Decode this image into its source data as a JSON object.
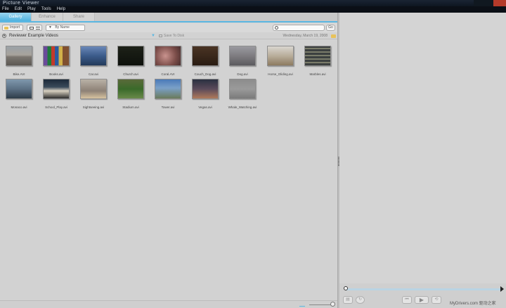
{
  "window": {
    "title": "Picture Viewer"
  },
  "menu": {
    "items": [
      "File",
      "Edit",
      "Play",
      "Tools",
      "Help"
    ]
  },
  "tabs": [
    {
      "label": "Gallery",
      "active": true
    },
    {
      "label": "Enhance",
      "active": false
    },
    {
      "label": "Share",
      "active": false
    }
  ],
  "toolbar": {
    "import_label": "Import",
    "sort_value": "By Name",
    "go_label": "Go"
  },
  "album": {
    "title": "Reviewer Example Videos",
    "save_label": "Save To Disk",
    "date": "Wednesday, March 19, 2008"
  },
  "gallery": {
    "items": [
      {
        "label": "Bike.AVI",
        "style": "t-bike"
      },
      {
        "label": "Books.avi",
        "style": "t-books"
      },
      {
        "label": "Car.avi",
        "style": "t-car"
      },
      {
        "label": "Church.avi",
        "style": "t-church"
      },
      {
        "label": "Coral.AVI",
        "style": "t-coral"
      },
      {
        "label": "Couch_Dog.avi",
        "style": "t-couch"
      },
      {
        "label": "Dog.avi",
        "style": "t-dog"
      },
      {
        "label": "Horse_Gliding.avi",
        "style": "t-horse"
      },
      {
        "label": "Marbles.avi",
        "style": "t-marbles"
      },
      {
        "label": "Monaco.avi",
        "style": "t-monaco"
      },
      {
        "label": "School_Play.avi",
        "style": "t-school"
      },
      {
        "label": "Sightseeing.avi",
        "style": "t-sight"
      },
      {
        "label": "Stadium.avi",
        "style": "t-stadium"
      },
      {
        "label": "Tower.avi",
        "style": "t-tower"
      },
      {
        "label": "Vegas.avi",
        "style": "t-vegas"
      },
      {
        "label": "Whale_Watching.avi",
        "style": "t-whale"
      }
    ]
  },
  "watermark": "MyDrivers.com 驱动之家",
  "colors": {
    "accent": "#5ab7e2",
    "background": "#d2d2d2",
    "menubar": "#0b0f16"
  }
}
